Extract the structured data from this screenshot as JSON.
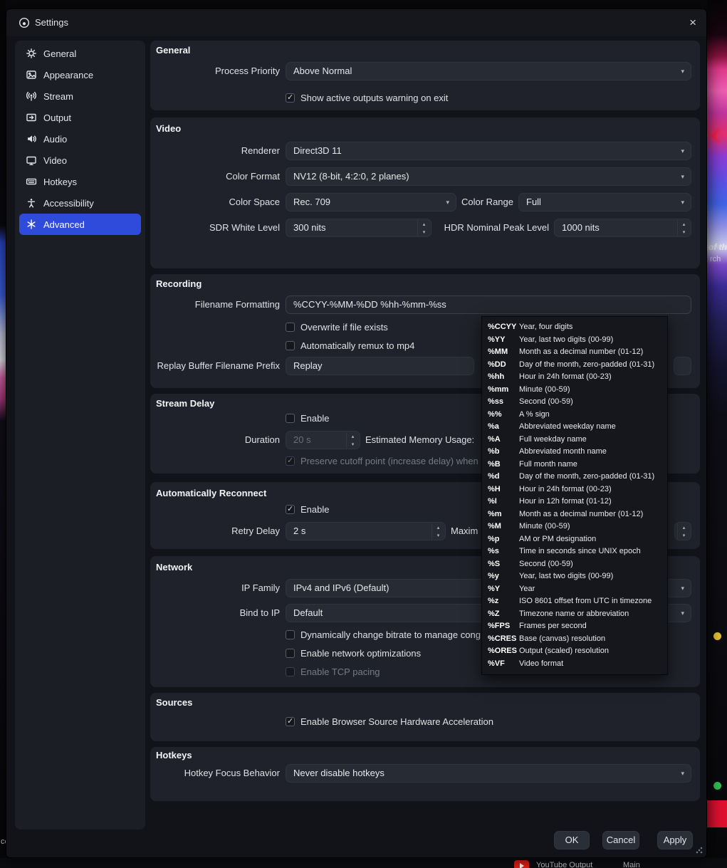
{
  "window": {
    "title": "Settings",
    "close": "×"
  },
  "sidebar": {
    "items": [
      {
        "label": "General"
      },
      {
        "label": "Appearance"
      },
      {
        "label": "Stream"
      },
      {
        "label": "Output"
      },
      {
        "label": "Audio"
      },
      {
        "label": "Video"
      },
      {
        "label": "Hotkeys"
      },
      {
        "label": "Accessibility"
      },
      {
        "label": "Advanced"
      }
    ]
  },
  "general": {
    "title": "General",
    "process_priority_label": "Process Priority",
    "process_priority_value": "Above Normal",
    "show_warning_label": "Show active outputs warning on exit"
  },
  "video": {
    "title": "Video",
    "renderer_label": "Renderer",
    "renderer_value": "Direct3D 11",
    "color_format_label": "Color Format",
    "color_format_value": "NV12 (8-bit, 4:2:0, 2 planes)",
    "color_space_label": "Color Space",
    "color_space_value": "Rec. 709",
    "color_range_label": "Color Range",
    "color_range_value": "Full",
    "sdr_white_label": "SDR White Level",
    "sdr_white_value": "300 nits",
    "hdr_peak_label": "HDR Nominal Peak Level",
    "hdr_peak_value": "1000 nits"
  },
  "recording": {
    "title": "Recording",
    "filename_label": "Filename Formatting",
    "filename_value": "%CCYY-%MM-%DD %hh-%mm-%ss",
    "overwrite_label": "Overwrite if file exists",
    "remux_label": "Automatically remux to mp4",
    "replay_prefix_label": "Replay Buffer Filename Prefix",
    "replay_prefix_value": "Replay"
  },
  "format_tooltip": {
    "rows": [
      {
        "spec": "%CCYY",
        "desc": "Year, four digits"
      },
      {
        "spec": "%YY",
        "desc": "Year, last two digits (00-99)"
      },
      {
        "spec": "%MM",
        "desc": "Month as a decimal number (01-12)"
      },
      {
        "spec": "%DD",
        "desc": "Day of the month, zero-padded (01-31)"
      },
      {
        "spec": "%hh",
        "desc": "Hour in 24h format (00-23)"
      },
      {
        "spec": "%mm",
        "desc": "Minute (00-59)"
      },
      {
        "spec": "%ss",
        "desc": "Second (00-59)"
      },
      {
        "spec": "%%",
        "desc": "A % sign"
      },
      {
        "spec": "%a",
        "desc": "Abbreviated weekday name"
      },
      {
        "spec": "%A",
        "desc": "Full weekday name"
      },
      {
        "spec": "%b",
        "desc": "Abbreviated month name"
      },
      {
        "spec": "%B",
        "desc": "Full month name"
      },
      {
        "spec": "%d",
        "desc": "Day of the month, zero-padded (01-31)"
      },
      {
        "spec": "%H",
        "desc": "Hour in 24h format (00-23)"
      },
      {
        "spec": "%I",
        "desc": "Hour in 12h format (01-12)"
      },
      {
        "spec": "%m",
        "desc": "Month as a decimal number (01-12)"
      },
      {
        "spec": "%M",
        "desc": "Minute (00-59)"
      },
      {
        "spec": "%p",
        "desc": "AM or PM designation"
      },
      {
        "spec": "%s",
        "desc": "Time in seconds since UNIX epoch"
      },
      {
        "spec": "%S",
        "desc": "Second (00-59)"
      },
      {
        "spec": "%y",
        "desc": "Year, last two digits (00-99)"
      },
      {
        "spec": "%Y",
        "desc": "Year"
      },
      {
        "spec": "%z",
        "desc": "ISO 8601 offset from UTC in timezone"
      },
      {
        "spec": "%Z",
        "desc": "Timezone name or abbreviation"
      },
      {
        "spec": "%FPS",
        "desc": "Frames per second"
      },
      {
        "spec": "%CRES",
        "desc": "Base (canvas) resolution"
      },
      {
        "spec": "%ORES",
        "desc": "Output (scaled) resolution"
      },
      {
        "spec": "%VF",
        "desc": "Video format"
      }
    ]
  },
  "stream_delay": {
    "title": "Stream Delay",
    "enable_label": "Enable",
    "duration_label": "Duration",
    "duration_value": "20 s",
    "memory_label": "Estimated Memory Usage:",
    "preserve_label": "Preserve cutoff point (increase delay) when"
  },
  "reconnect": {
    "title": "Automatically Reconnect",
    "enable_label": "Enable",
    "retry_delay_label": "Retry Delay",
    "retry_delay_value": "2 s",
    "max_retries_label": "Maxim"
  },
  "network": {
    "title": "Network",
    "ip_family_label": "IP Family",
    "ip_family_value": "IPv4 and IPv6 (Default)",
    "bind_label": "Bind to IP",
    "bind_value": "Default",
    "dynamic_bitrate_label": "Dynamically change bitrate to manage cong",
    "optimizations_label": "Enable network optimizations",
    "tcp_pacing_label": "Enable TCP pacing"
  },
  "sources": {
    "title": "Sources",
    "browser_accel_label": "Enable Browser Source Hardware Acceleration"
  },
  "hotkeys_section": {
    "title": "Hotkeys",
    "focus_label": "Hotkey Focus Behavior",
    "focus_value": "Never disable hotkeys"
  },
  "footer": {
    "ok": "OK",
    "cancel": "Cancel",
    "apply": "Apply"
  },
  "background": {
    "edge_text_1": "of th",
    "edge_text_2": "rch",
    "corner_text": "ce",
    "bottom_stream_label": "YouTube Output",
    "bottom_scene_label": "Main"
  }
}
